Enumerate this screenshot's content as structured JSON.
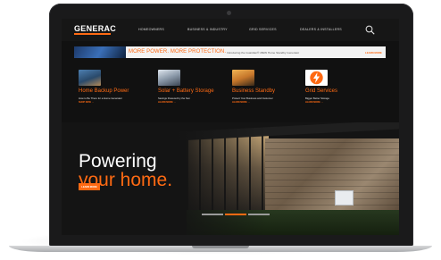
{
  "nav": {
    "logo": "GENERAC",
    "items": [
      "HOMEOWNERS",
      "BUSINESS & INDUSTRY",
      "GRID SERVICES",
      "DEALERS & INSTALLERS"
    ]
  },
  "promo": {
    "headline": "MORE POWER. MORE PROTECTION.",
    "subtext": "Introducing the Guardian® 28kW Home Standby Generator",
    "link": "LEARN MORE"
  },
  "tiles": [
    {
      "title": "Home Backup Power",
      "desc": "How to Be There for a Home Generator",
      "link": "SHOP NOW →"
    },
    {
      "title": "Solar + Battery Storage",
      "desc": "Savings Powered by the Sun",
      "link": "LEARN MORE →"
    },
    {
      "title": "Business Standby",
      "desc": "Protect Your Business and Customer",
      "link": "LEARN MORE →"
    },
    {
      "title": "Grid Services",
      "desc": "Bigger Better Storage",
      "link": "LEARN MORE →"
    }
  ],
  "hero": {
    "line1": "Powering",
    "line2": "your home.",
    "button": "LEARN MORE"
  },
  "colors": {
    "accent": "#ff6a13",
    "background": "#111111"
  }
}
